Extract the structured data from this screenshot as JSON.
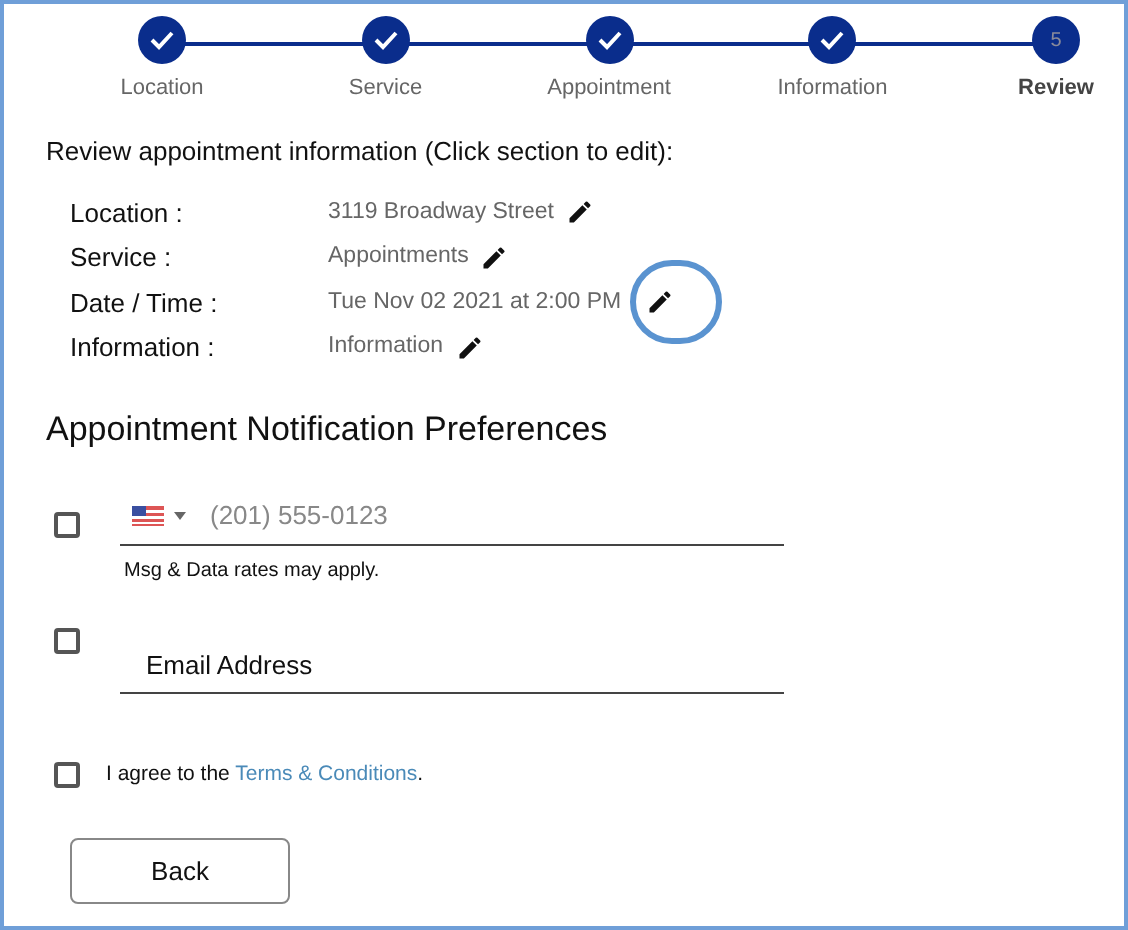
{
  "steps": [
    {
      "label": "Location",
      "completed": true,
      "selected": false
    },
    {
      "label": "Service",
      "completed": true,
      "selected": false
    },
    {
      "label": "Appointment",
      "completed": true,
      "selected": false
    },
    {
      "label": "Information",
      "completed": true,
      "selected": false
    },
    {
      "label": "Review",
      "number": "5",
      "completed": false,
      "selected": true
    }
  ],
  "review": {
    "title": "Review appointment information (Click section to edit):",
    "rows": [
      {
        "label": "Location :",
        "value": "3119 Broadway Street",
        "highlighted": false
      },
      {
        "label": "Service :",
        "value": "Appointments",
        "highlighted": false
      },
      {
        "label": "Date / Time :",
        "value": "Tue Nov 02 2021 at 2:00 PM",
        "highlighted": true
      },
      {
        "label": "Information :",
        "value": "Information",
        "highlighted": false
      }
    ]
  },
  "notifications": {
    "title": "Appointment Notification Preferences",
    "phone": {
      "checked": false,
      "placeholder": "(201) 555-0123",
      "note": "Msg & Data rates may apply."
    },
    "email": {
      "checked": false,
      "placeholder": "Email Address"
    },
    "terms": {
      "checked": false,
      "text": "I agree to the ",
      "link": "Terms & Conditions",
      "suffix": "."
    }
  },
  "buttons": [
    {
      "label": "Back"
    }
  ]
}
